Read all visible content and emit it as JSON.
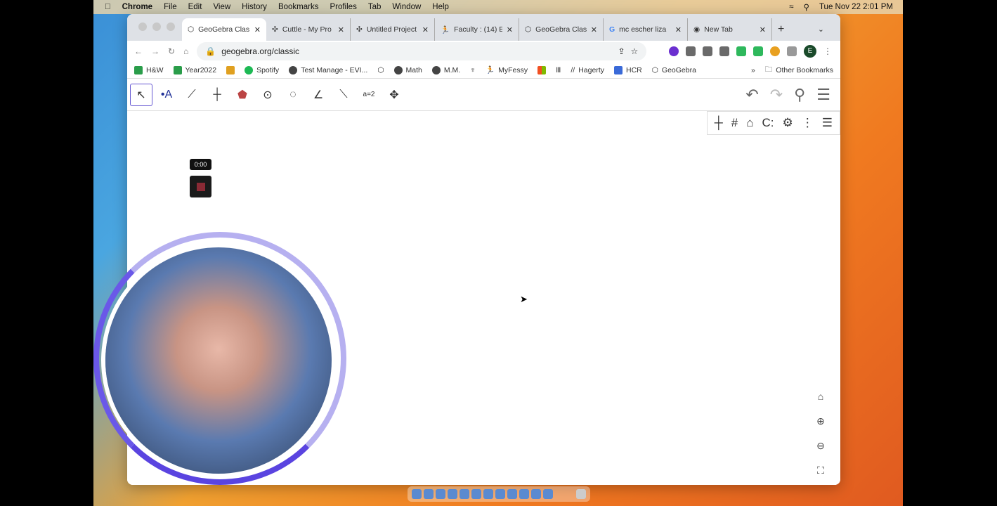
{
  "menubar": {
    "app": "Chrome",
    "items": [
      "File",
      "Edit",
      "View",
      "History",
      "Bookmarks",
      "Profiles",
      "Tab",
      "Window",
      "Help"
    ],
    "clock": "Tue Nov 22  2:01 PM"
  },
  "tabs": [
    {
      "title": "GeoGebra Clas"
    },
    {
      "title": "Cuttle - My Pro"
    },
    {
      "title": "Untitled Project"
    },
    {
      "title": "Faculty : (14) B"
    },
    {
      "title": "GeoGebra Clas"
    },
    {
      "title": "mc escher liza"
    },
    {
      "title": "New Tab"
    }
  ],
  "address": {
    "url": "geogebra.org/classic",
    "profile": "E"
  },
  "bookmarks": [
    "H&W",
    "Year2022",
    "",
    "Spotify",
    "Test Manage - EVI...",
    "",
    "Math",
    "M.M.",
    "",
    "MyFessy",
    "",
    "",
    "Hagerty",
    "HCR",
    "GeoGebra"
  ],
  "other_bookmarks": "Other Bookmarks",
  "geogebra": {
    "tools": [
      "move",
      "point",
      "line",
      "perpendicular",
      "polygon",
      "circle",
      "conic",
      "angle",
      "reflect",
      "slider",
      "move-view"
    ],
    "slider_label": "a=2"
  },
  "recorder": {
    "time": "0:00"
  },
  "colors": {
    "accent": "#6557d2",
    "ring": "#5a44e0"
  }
}
